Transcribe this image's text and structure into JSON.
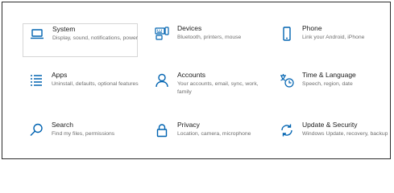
{
  "settings": {
    "accent_color": "#0063b1",
    "tiles": [
      {
        "title": "System",
        "description": "Display, sound, notifications, power",
        "icon": "laptop-icon",
        "selected": true
      },
      {
        "title": "Devices",
        "description": "Bluetooth, printers, mouse",
        "icon": "keyboard-icon"
      },
      {
        "title": "Phone",
        "description": "Link your Android, iPhone",
        "icon": "phone-icon"
      },
      {
        "title": "Apps",
        "description": "Uninstall, defaults, optional features",
        "icon": "apps-list-icon"
      },
      {
        "title": "Accounts",
        "description": "Your accounts, email, sync, work, family",
        "icon": "person-icon"
      },
      {
        "title": "Time & Language",
        "description": "Speech, region, date",
        "icon": "time-language-icon"
      },
      {
        "title": "Search",
        "description": "Find my files, permissions",
        "icon": "search-icon"
      },
      {
        "title": "Privacy",
        "description": "Location, camera, microphone",
        "icon": "lock-icon"
      },
      {
        "title": "Update & Security",
        "description": "Windows Update, recovery, backup",
        "icon": "sync-arrows-icon"
      }
    ]
  }
}
